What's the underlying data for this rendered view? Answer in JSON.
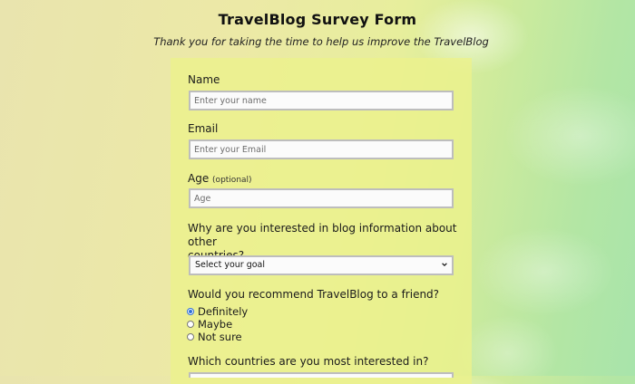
{
  "header": {
    "title": "TravelBlog Survey Form",
    "subtitle": "Thank you for taking the time to help us improve the TravelBlog"
  },
  "form": {
    "name": {
      "label": "Name",
      "placeholder": "Enter your name",
      "value": ""
    },
    "email": {
      "label": "Email",
      "placeholder": "Enter your Email",
      "value": ""
    },
    "age": {
      "label": "Age",
      "optional_note": "(optional)",
      "placeholder": "Age",
      "value": ""
    },
    "interest": {
      "label_line1": "Why are you interested in blog information about other",
      "label_line2": "countries?",
      "selected": "Select your goal"
    },
    "recommend": {
      "label": "Would you recommend TravelBlog to a friend?",
      "options": [
        {
          "label": "Definitely",
          "checked": true
        },
        {
          "label": "Maybe",
          "checked": false
        },
        {
          "label": "Not sure",
          "checked": false
        }
      ]
    },
    "countries": {
      "label": "Which countries are you most interested in?"
    }
  },
  "colors": {
    "card_background": "#ecf28c",
    "input_border": "#bdbdbd",
    "radio_accent": "#2f6fd6"
  }
}
